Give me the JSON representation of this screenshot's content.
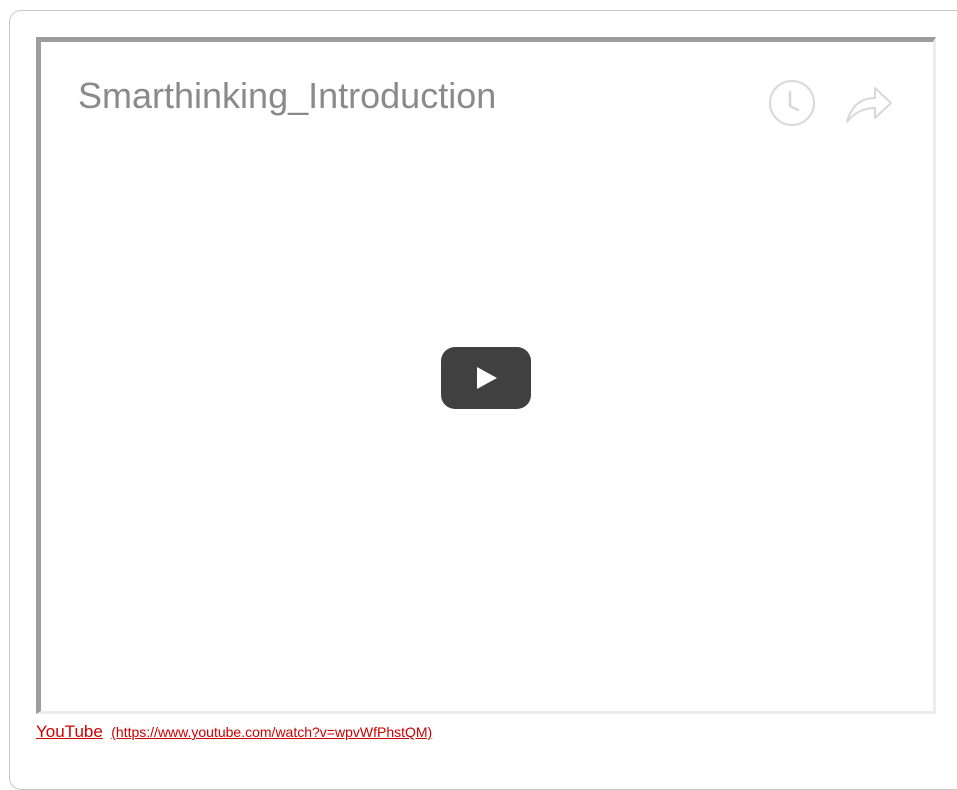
{
  "video": {
    "title": "Smarthinking_Introduction",
    "icons": {
      "watch_later": "clock-icon",
      "share": "share-arrow-icon",
      "play": "play-icon"
    }
  },
  "source": {
    "name": "YouTube",
    "url": "(https://www.youtube.com/watch?v=wpvWfPhstQM)"
  },
  "colors": {
    "link": "#cc0000",
    "title": "#8a8a8a",
    "play_button": "#404040"
  }
}
